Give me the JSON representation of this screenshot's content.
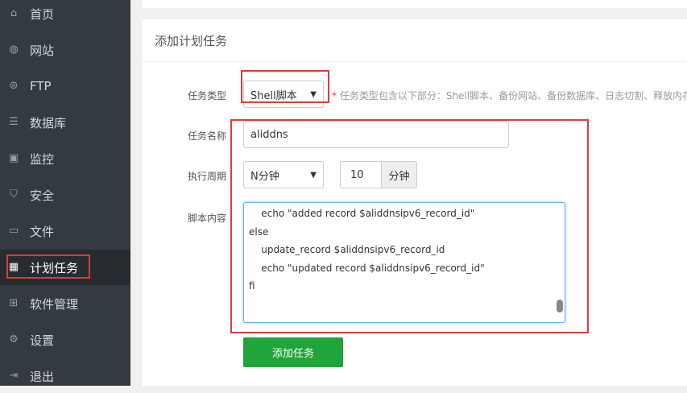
{
  "sidebar": {
    "items": [
      {
        "label": "首页",
        "icon": "home-icon"
      },
      {
        "label": "网站",
        "icon": "globe-icon"
      },
      {
        "label": "FTP",
        "icon": "ftp-icon"
      },
      {
        "label": "数据库",
        "icon": "database-icon"
      },
      {
        "label": "监控",
        "icon": "monitor-icon"
      },
      {
        "label": "安全",
        "icon": "shield-icon"
      },
      {
        "label": "文件",
        "icon": "folder-icon"
      },
      {
        "label": "计划任务",
        "icon": "calendar-icon"
      },
      {
        "label": "软件管理",
        "icon": "apps-icon"
      },
      {
        "label": "设置",
        "icon": "gear-icon"
      },
      {
        "label": "退出",
        "icon": "logout-icon"
      }
    ]
  },
  "form": {
    "title": "添加计划任务",
    "task_type_label": "任务类型",
    "task_type_value": "Shell脚本",
    "hint_star": "*",
    "hint": "任务类型包含以下部分：Shell脚本、备份网站、备份数据库、日志切割、释放内存",
    "task_name_label": "任务名称",
    "task_name_value": "aliddns",
    "period_label": "执行周期",
    "period_value": "N分钟",
    "period_n": "10",
    "period_unit": "分钟",
    "script_label": "脚本内容",
    "script": "    echo \"added record $aliddnsipv6_record_id\"\nelse\n    update_record $aliddnsipv6_record_id\n    echo \"updated record $aliddnsipv6_record_id\"\nfi",
    "submit": "添加任务"
  }
}
